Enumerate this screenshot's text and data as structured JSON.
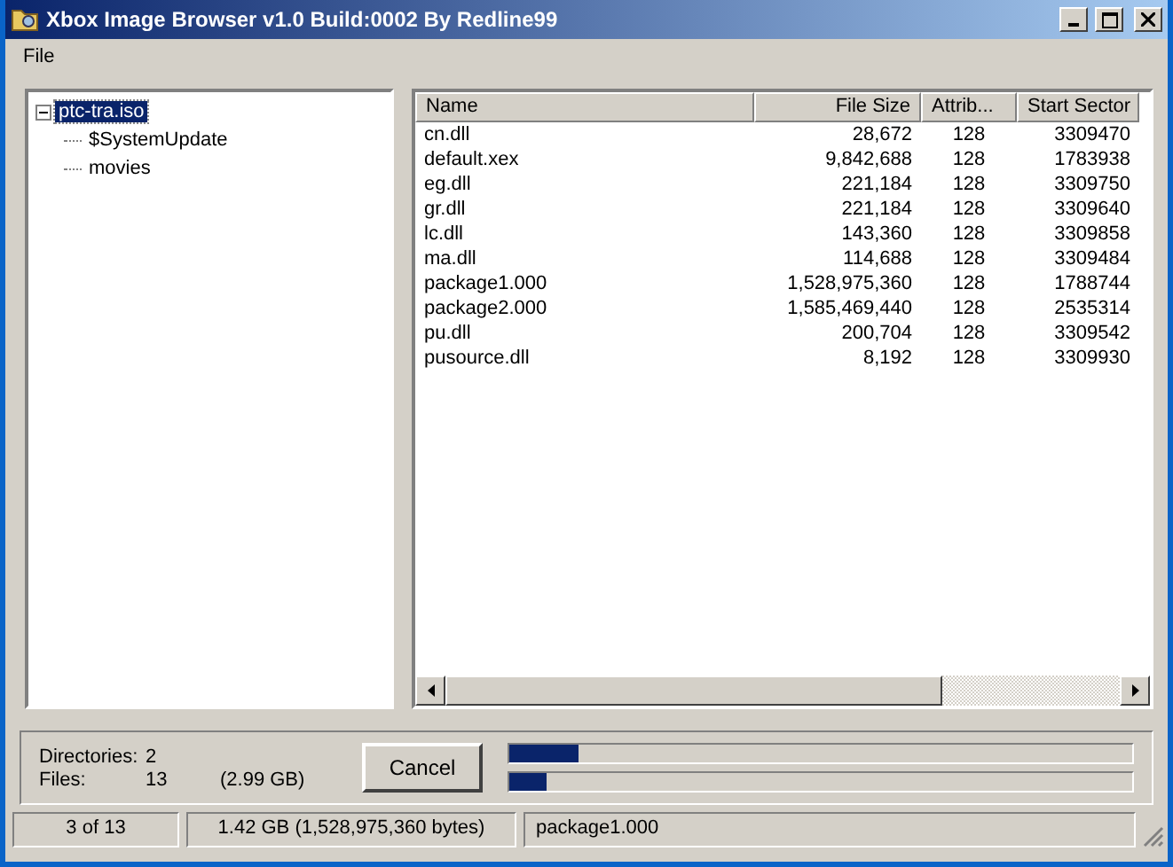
{
  "window": {
    "title": "Xbox Image Browser v1.0 Build:0002 By Redline99"
  },
  "menu": [
    "File"
  ],
  "tree": {
    "label": "ptc-tra.iso",
    "expanded": true,
    "selected": true,
    "children": [
      {
        "label": "$SystemUpdate",
        "selected": false
      },
      {
        "label": "movies",
        "selected": false
      }
    ]
  },
  "table": {
    "columns": [
      "Name",
      "File Size",
      "Attrib...",
      "Start Sector"
    ],
    "rows": [
      [
        "cn.dll",
        "28,672",
        "128",
        "3309470"
      ],
      [
        "default.xex",
        "9,842,688",
        "128",
        "1783938"
      ],
      [
        "eg.dll",
        "221,184",
        "128",
        "3309750"
      ],
      [
        "gr.dll",
        "221,184",
        "128",
        "3309640"
      ],
      [
        "lc.dll",
        "143,360",
        "128",
        "3309858"
      ],
      [
        "ma.dll",
        "114,688",
        "128",
        "3309484"
      ],
      [
        "package1.000",
        "1,528,975,360",
        "128",
        "1788744"
      ],
      [
        "package2.000",
        "1,585,469,440",
        "128",
        "2535314"
      ],
      [
        "pu.dll",
        "200,704",
        "128",
        "3309542"
      ],
      [
        "pusource.dll",
        "8,192",
        "128",
        "3309930"
      ]
    ]
  },
  "summary": {
    "directories_label": "Directories:",
    "directories": "2",
    "files_label": "Files:",
    "files": "13",
    "size": "(2.99 GB)"
  },
  "cancel_button": "Cancel",
  "progress": [
    {
      "level": 0.11
    },
    {
      "level": 0.06
    }
  ],
  "status_bar": [
    "3 of 13",
    "1.42 GB (1,528,975,360 bytes)",
    "package1.000"
  ]
}
